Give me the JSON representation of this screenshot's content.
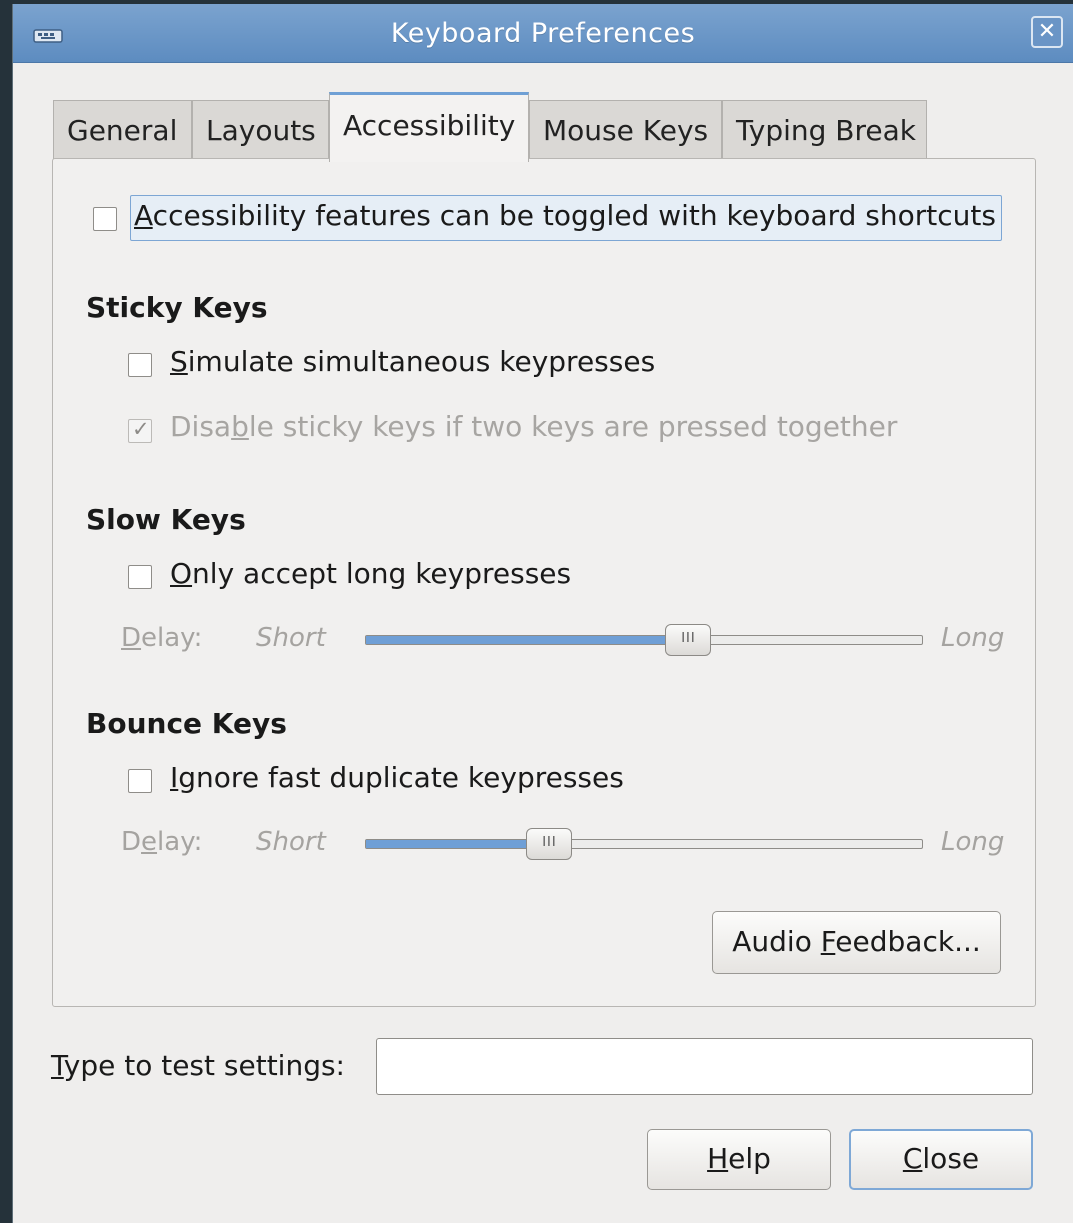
{
  "window": {
    "title": "Keyboard Preferences",
    "icon": "keyboard-icon",
    "close_icon": "close-icon"
  },
  "tabs": [
    {
      "label": "General",
      "active": false
    },
    {
      "label": "Layouts",
      "active": false
    },
    {
      "label": "Accessibility",
      "active": true
    },
    {
      "label": "Mouse Keys",
      "active": false
    },
    {
      "label": "Typing Break",
      "active": false
    }
  ],
  "toggle_shortcuts": {
    "pre": "",
    "mnemonic": "A",
    "post": "ccessibility features can be toggled with keyboard shortcuts",
    "checked": false
  },
  "sticky_keys": {
    "heading": "Sticky Keys",
    "simulate": {
      "pre": "",
      "mnemonic": "S",
      "post": "imulate simultaneous keypresses",
      "checked": false
    },
    "disable": {
      "pre": "Disa",
      "mnemonic": "b",
      "post": "le sticky keys if two keys are pressed together",
      "checked": true,
      "enabled": false
    }
  },
  "slow_keys": {
    "heading": "Slow Keys",
    "only_long": {
      "pre": "",
      "mnemonic": "O",
      "post": "nly accept long keypresses",
      "checked": false
    },
    "delay": {
      "pre": "",
      "mnemonic": "D",
      "post": "elay:",
      "short": "Short",
      "long": "Long",
      "value": 0.58
    }
  },
  "bounce_keys": {
    "heading": "Bounce Keys",
    "ignore_fast": {
      "pre": "",
      "mnemonic": "I",
      "post": "gnore fast duplicate keypresses",
      "checked": false
    },
    "delay": {
      "pre": "D",
      "mnemonic": "e",
      "post": "lay:",
      "short": "Short",
      "long": "Long",
      "value": 0.33
    }
  },
  "audio_feedback": {
    "pre": "Audio ",
    "mnemonic": "F",
    "post": "eedback..."
  },
  "test": {
    "pre": "",
    "mnemonic": "T",
    "post": "ype to test settings:",
    "value": ""
  },
  "buttons": {
    "help": {
      "pre": "",
      "mnemonic": "H",
      "post": "elp"
    },
    "close": {
      "pre": "",
      "mnemonic": "C",
      "post": "lose"
    }
  }
}
